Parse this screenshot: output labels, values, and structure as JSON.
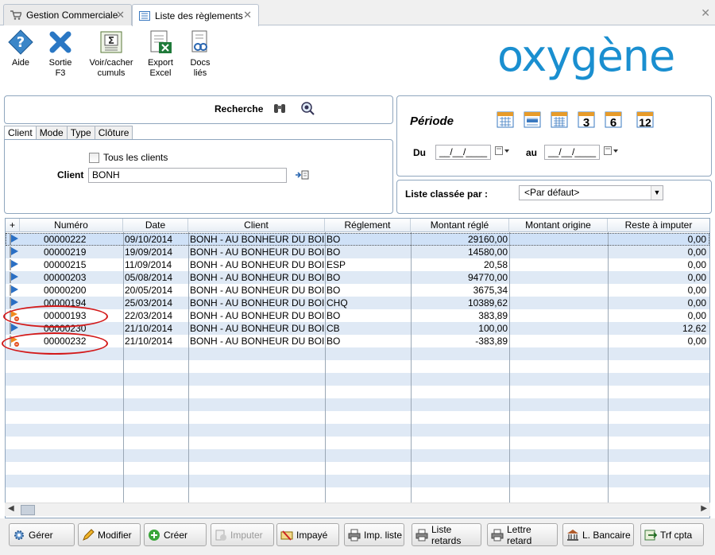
{
  "tabs": [
    {
      "label": "Gestion Commerciale"
    },
    {
      "label": "Liste des règlements"
    }
  ],
  "toolbar": {
    "aide": "Aide",
    "sortie1": "Sortie",
    "sortie2": "F3",
    "voir1": "Voir/cacher",
    "voir2": "cumuls",
    "export1": "Export",
    "export2": "Excel",
    "docs1": "Docs",
    "docs2": "liés"
  },
  "logo": "oxygène",
  "search": {
    "label": "Recherche",
    "subtabs": [
      "Client",
      "Mode",
      "Type",
      "Clôture"
    ],
    "tous": "Tous les clients",
    "client_label": "Client",
    "client_value": "BONH"
  },
  "periode": {
    "label": "Période",
    "du": "Du",
    "au": "au",
    "date_placeholder": "__/__/____",
    "cal3": "3",
    "cal6": "6",
    "cal12": "12"
  },
  "tri": {
    "label": "Liste classée par :",
    "value": "<Par défaut>"
  },
  "columns": [
    "Numéro",
    "Date",
    "Client",
    "Réglement",
    "Montant réglé",
    "Montant origine",
    "Reste à imputer"
  ],
  "rows": [
    {
      "num": "00000222",
      "date": "09/10/2014",
      "client": "BONH - AU BONHEUR DU BOIS",
      "reg": "BO",
      "montant": "29160,00",
      "origine": "",
      "reste": "0,00"
    },
    {
      "num": "00000219",
      "date": "19/09/2014",
      "client": "BONH - AU BONHEUR DU BOIS",
      "reg": "BO",
      "montant": "14580,00",
      "origine": "",
      "reste": "0,00"
    },
    {
      "num": "00000215",
      "date": "11/09/2014",
      "client": "BONH - AU BONHEUR DU BOIS",
      "reg": "ESP",
      "montant": "20,58",
      "origine": "",
      "reste": "0,00"
    },
    {
      "num": "00000203",
      "date": "05/08/2014",
      "client": "BONH - AU BONHEUR DU BOIS",
      "reg": "BO",
      "montant": "94770,00",
      "origine": "",
      "reste": "0,00"
    },
    {
      "num": "00000200",
      "date": "20/05/2014",
      "client": "BONH - AU BONHEUR DU BOIS",
      "reg": "BO",
      "montant": "3675,34",
      "origine": "",
      "reste": "0,00"
    },
    {
      "num": "00000194",
      "date": "25/03/2014",
      "client": "BONH - AU BONHEUR DU BOIS",
      "reg": "CHQ",
      "montant": "10389,62",
      "origine": "",
      "reste": "0,00"
    },
    {
      "num": "00000193",
      "date": "22/03/2014",
      "client": "BONH - AU BONHEUR DU BOIS",
      "reg": "BO",
      "montant": "383,89",
      "origine": "",
      "reste": "0,00"
    },
    {
      "num": "00000230",
      "date": "21/10/2014",
      "client": "BONH - AU BONHEUR DU BOIS",
      "reg": "CB",
      "montant": "100,00",
      "origine": "",
      "reste": "12,62"
    },
    {
      "num": "00000232",
      "date": "21/10/2014",
      "client": "BONH - AU BONHEUR DU BOIS",
      "reg": "BO",
      "montant": "-383,89",
      "origine": "",
      "reste": "0,00"
    }
  ],
  "buttons": {
    "gerer": "Gérer",
    "modifier": "Modifier",
    "creer": "Créer",
    "imputer": "Imputer",
    "impaye": "Impayé",
    "impliste": "Imp. liste",
    "retards": "Liste retards",
    "lettre": "Lettre retard",
    "bancaire": "L. Bancaire",
    "trf": "Trf cpta"
  },
  "colors": {
    "accent": "#1a8fd0",
    "annotation": "#d31919"
  }
}
